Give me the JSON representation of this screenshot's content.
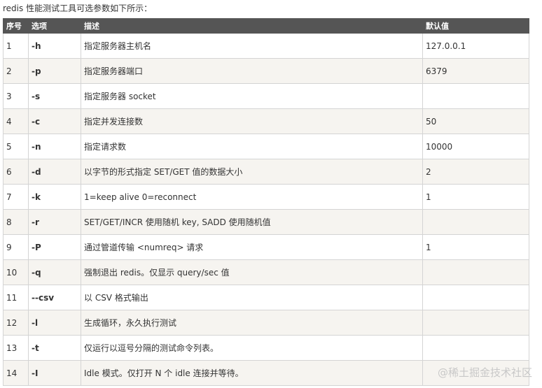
{
  "intro": "redis 性能测试工具可选参数如下所示：",
  "table": {
    "headers": [
      "序号",
      "选项",
      "描述",
      "默认值"
    ],
    "rows": [
      {
        "no": "1",
        "opt": "-h",
        "desc": "指定服务器主机名",
        "def": "127.0.0.1"
      },
      {
        "no": "2",
        "opt": "-p",
        "desc": "指定服务器端口",
        "def": "6379"
      },
      {
        "no": "3",
        "opt": "-s",
        "desc": "指定服务器 socket",
        "def": ""
      },
      {
        "no": "4",
        "opt": "-c",
        "desc": "指定并发连接数",
        "def": "50"
      },
      {
        "no": "5",
        "opt": "-n",
        "desc": "指定请求数",
        "def": "10000"
      },
      {
        "no": "6",
        "opt": "-d",
        "desc": "以字节的形式指定 SET/GET 值的数据大小",
        "def": "2"
      },
      {
        "no": "7",
        "opt": "-k",
        "desc": "1=keep alive 0=reconnect",
        "def": "1"
      },
      {
        "no": "8",
        "opt": "-r",
        "desc": "SET/GET/INCR 使用随机 key, SADD 使用随机值",
        "def": ""
      },
      {
        "no": "9",
        "opt": "-P",
        "desc": "通过管道传输 <numreq> 请求",
        "def": "1"
      },
      {
        "no": "10",
        "opt": "-q",
        "desc": "强制退出 redis。仅显示 query/sec 值",
        "def": ""
      },
      {
        "no": "11",
        "opt": "--csv",
        "desc": "以 CSV 格式输出",
        "def": ""
      },
      {
        "no": "12",
        "opt": "-l",
        "desc": "生成循环，永久执行测试",
        "def": ""
      },
      {
        "no": "13",
        "opt": "-t",
        "desc": "仅运行以逗号分隔的测试命令列表。",
        "def": ""
      },
      {
        "no": "14",
        "opt": "-I",
        "desc": "Idle 模式。仅打开 N 个 idle 连接并等待。",
        "def": ""
      }
    ]
  },
  "watermark": "@稀土掘金技术社区"
}
